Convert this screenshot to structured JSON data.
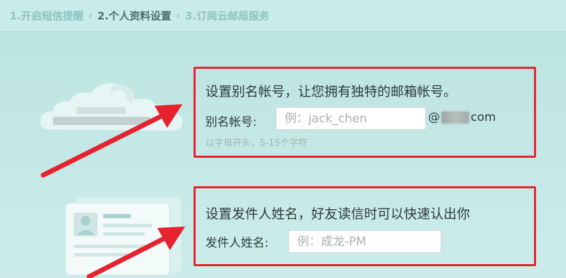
{
  "steps": [
    {
      "label": "1.开启短信提醒",
      "active": false
    },
    {
      "label": "2.个人资料设置",
      "active": true
    },
    {
      "label": "3.订阅云邮局服务",
      "active": false
    }
  ],
  "step_separator": "›",
  "alias_section": {
    "heading": "设置别名帐号，让您拥有独特的邮箱帐号。",
    "field_label": "别名帐号:",
    "input_placeholder": "例：jack_chen",
    "input_value": "",
    "at_sign": "@",
    "domain_suffix": "com",
    "hint": "以字母开头，5-15个字符"
  },
  "sender_section": {
    "heading": "设置发件人姓名，好友读信时可以快速认出你",
    "field_label": "发件人姓名:",
    "input_placeholder": "例：成龙-PM",
    "input_value": ""
  },
  "colors": {
    "highlight_border": "#e5232f",
    "arrow": "#e5232f",
    "background": "#bfe5e3",
    "active_step": "#4d6f6d",
    "inactive_step": "#8dc3bf"
  },
  "icons": {
    "cloud": "cloud-icon",
    "profile_card": "profile-card-icon",
    "arrow": "red-arrow-icon"
  }
}
